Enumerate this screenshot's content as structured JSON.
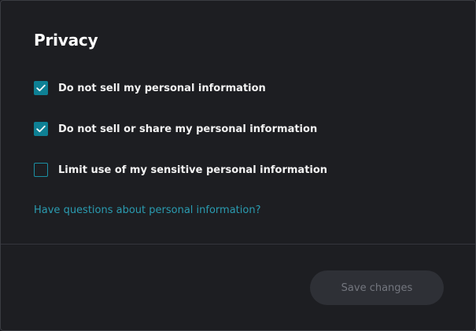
{
  "privacy": {
    "title": "Privacy",
    "options": [
      {
        "label": "Do not sell my personal information",
        "checked": true
      },
      {
        "label": "Do not sell or share my personal information",
        "checked": true
      },
      {
        "label": "Limit use of my sensitive personal information",
        "checked": false
      }
    ],
    "help_link": "Have questions about personal information?"
  },
  "footer": {
    "save_label": "Save changes",
    "save_disabled": true
  },
  "colors": {
    "accent": "#0e8094",
    "link": "#2a9bb0",
    "background": "#1d1e22",
    "button_disabled_bg": "#2e3036",
    "button_disabled_text": "#73767e"
  },
  "icons": {
    "checkmark": "check-icon"
  }
}
